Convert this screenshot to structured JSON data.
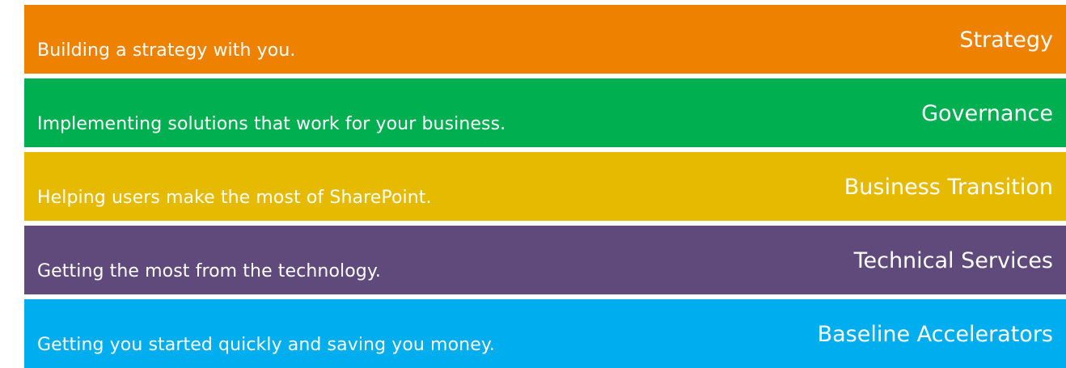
{
  "bands": [
    {
      "tagline": "Building a strategy with you.",
      "service": "Strategy",
      "color": "#EE8200"
    },
    {
      "tagline": "Implementing solutions that work for your business.",
      "service": "Governance",
      "color": "#00AF50"
    },
    {
      "tagline": "Helping users make the most of SharePoint.",
      "service": "Business Transition",
      "color": "#E6BA00"
    },
    {
      "tagline": "Getting the most from the technology.",
      "service": "Technical Services",
      "color": "#604A7B"
    },
    {
      "tagline": "Getting you started quickly and saving you money.",
      "service": "Baseline Accelerators",
      "color": "#00AEEF"
    }
  ]
}
